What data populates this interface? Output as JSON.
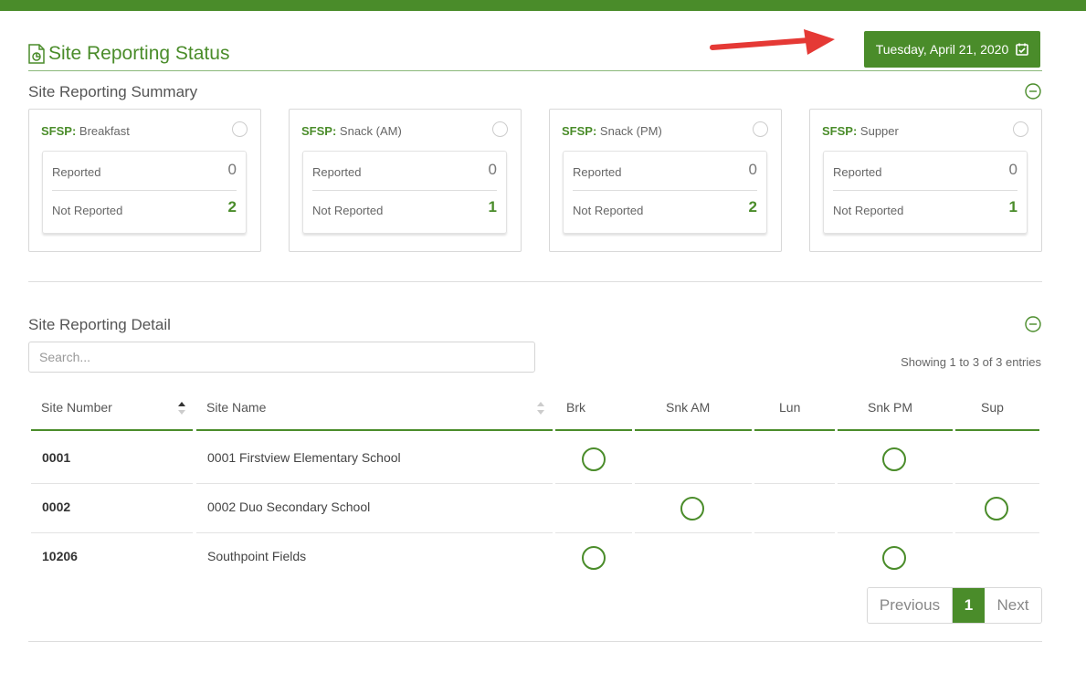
{
  "page": {
    "title": "Site Reporting Status",
    "date_button": "Tuesday, April 21, 2020",
    "colors": {
      "accent": "#4a8c2a",
      "arrow": "#e53935"
    }
  },
  "summary": {
    "title": "Site Reporting Summary",
    "cards": [
      {
        "program": "SFSP:",
        "meal": "Breakfast",
        "reported_label": "Reported",
        "reported": "0",
        "not_reported_label": "Not Reported",
        "not_reported": "2"
      },
      {
        "program": "SFSP:",
        "meal": "Snack (AM)",
        "reported_label": "Reported",
        "reported": "0",
        "not_reported_label": "Not Reported",
        "not_reported": "1"
      },
      {
        "program": "SFSP:",
        "meal": "Snack (PM)",
        "reported_label": "Reported",
        "reported": "0",
        "not_reported_label": "Not Reported",
        "not_reported": "2"
      },
      {
        "program": "SFSP:",
        "meal": "Supper",
        "reported_label": "Reported",
        "reported": "0",
        "not_reported_label": "Not Reported",
        "not_reported": "1"
      }
    ]
  },
  "detail": {
    "title": "Site Reporting Detail",
    "search_placeholder": "Search...",
    "showing": "Showing 1 to 3 of 3 entries",
    "columns": [
      "Site Number",
      "Site Name",
      "Brk",
      "Snk AM",
      "Lun",
      "Snk PM",
      "Sup"
    ],
    "rows": [
      {
        "number": "0001",
        "name": "0001 Firstview Elementary School",
        "meals": {
          "brk": true,
          "snk_am": false,
          "lun": false,
          "snk_pm": true,
          "sup": false
        }
      },
      {
        "number": "0002",
        "name": "0002 Duo Secondary School",
        "meals": {
          "brk": false,
          "snk_am": true,
          "lun": false,
          "snk_pm": false,
          "sup": true
        }
      },
      {
        "number": "10206",
        "name": "Southpoint Fields",
        "meals": {
          "brk": true,
          "snk_am": false,
          "lun": false,
          "snk_pm": true,
          "sup": false
        }
      }
    ],
    "pagination": {
      "previous": "Previous",
      "current": "1",
      "next": "Next"
    }
  }
}
